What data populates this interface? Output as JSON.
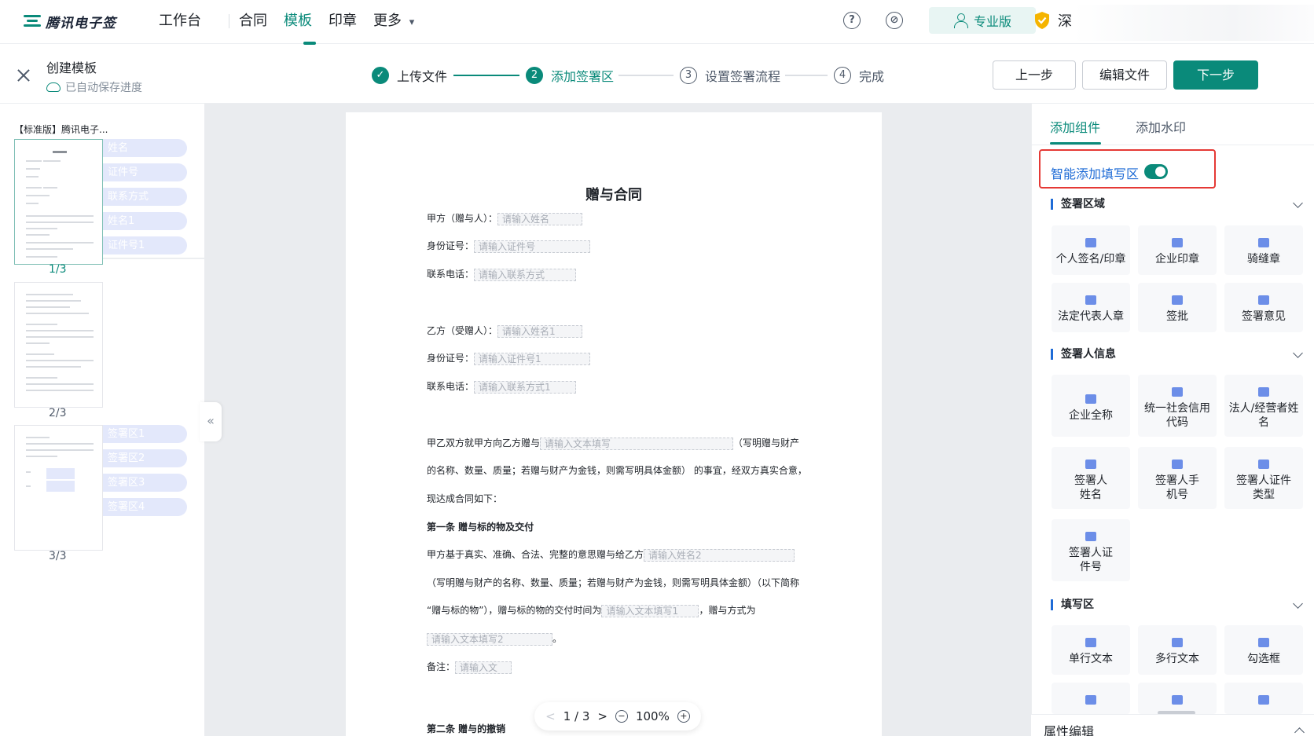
{
  "nav": {
    "logo_text": "腾讯电子签",
    "items": [
      {
        "label": "工作台",
        "active": false
      },
      {
        "label": "合同",
        "active": false
      },
      {
        "label": "模板",
        "active": true
      },
      {
        "label": "印章",
        "active": false
      },
      {
        "label": "更多",
        "active": false
      }
    ],
    "more_caret": "▾",
    "help_glyph": "?",
    "link_glyph": "⊘",
    "pro_label": "专业版",
    "org_name_partial": "深"
  },
  "stepbar": {
    "title": "创建模板",
    "autosave": "已自动保存进度",
    "steps": [
      {
        "num": "✓",
        "label": "上传文件",
        "state": "done"
      },
      {
        "num": "2",
        "label": "添加签署区",
        "state": "active"
      },
      {
        "num": "3",
        "label": "设置签署流程",
        "state": "todo"
      },
      {
        "num": "4",
        "label": "完成",
        "state": "todo"
      }
    ],
    "buttons": {
      "prev": "上一步",
      "edit": "编辑文件",
      "next": "下一步"
    }
  },
  "sidebar": {
    "doc_name": "【标准版】腾讯电子...",
    "pages": [
      {
        "label": "1/3",
        "active": true,
        "tags": [
          "姓名",
          "证件号",
          "联系方式",
          "姓名1",
          "证件号1"
        ]
      },
      {
        "label": "2/3",
        "active": false,
        "tags": []
      },
      {
        "label": "3/3",
        "active": false,
        "tags": [
          "签署区1",
          "签署区2",
          "签署区3",
          "签署区4"
        ]
      }
    ],
    "collapse_glyph": "«"
  },
  "document": {
    "title": "赠与合同",
    "lines": {
      "partyA": {
        "label": "甲方（赠与人）：",
        "field": "请输入姓名"
      },
      "idA": {
        "label": "身份证号：",
        "field": "请输入证件号"
      },
      "phoneA": {
        "label": "联系电话：",
        "field": "请输入联系方式"
      },
      "partyB": {
        "label": "乙方（受赠人）：",
        "field": "请输入姓名1"
      },
      "idB": {
        "label": "身份证号：",
        "field": "请输入证件号1"
      },
      "phoneB": {
        "label": "联系电话：",
        "field": "请输入联系方式1"
      },
      "p1a": "甲乙双方就甲方向乙方赠与",
      "p1field": "请输入文本填写",
      "p1b": "（写明赠与财产",
      "p2": "的名称、数量、质量；若赠与财产为金钱，则需写明具体金额） 的事宜，经双方真实合意，",
      "p3": "现达成合同如下：",
      "art1": "第一条  赠与标的物及交付",
      "p4a": "甲方基于真实、准确、合法、完整的意思赠与给乙方",
      "p4field": "请输入姓名2",
      "p5": "（写明赠与财产的名称、数量、质量；若赠与财产为金钱，则需写明具体金额）（以下简称",
      "p6a": "“赠与标的物”），赠与标的物的交付时间为",
      "p6field": "请输入文本填写1",
      "p6b": "，赠与方式为",
      "p7field": "请输入文本填写2",
      "p7b": "。",
      "remark_label": "备注：",
      "remark_field": "请输入文",
      "art2": "第二条   赠与的撤销"
    }
  },
  "pager": {
    "prev": "<",
    "page": "1 / 3",
    "next": ">",
    "zoom_out": "−",
    "zoom": "100%",
    "zoom_in": "+"
  },
  "rightpanel": {
    "tabs": [
      "添加组件",
      "添加水印"
    ],
    "smart_label": "智能添加填写区",
    "smart_on": true,
    "sections": [
      {
        "title": "签署区域",
        "items": [
          "个人签名/印章",
          "企业印章",
          "骑缝章",
          "法定代表人章",
          "签批",
          "签署意见"
        ]
      },
      {
        "title": "签署人信息",
        "items": [
          "企业全称",
          "统一社会信用代码",
          "法人/经营者姓名",
          "签署人姓名",
          "签署人手机号",
          "签署人证件类型",
          "签署人证件号"
        ]
      },
      {
        "title": "填写区",
        "items": [
          "单行文本",
          "多行文本",
          "勾选框"
        ]
      }
    ],
    "props_label": "属性编辑"
  },
  "colors": {
    "brand": "#0a8a7a",
    "link": "#1e6bd6",
    "highlight_border": "#e53935"
  }
}
